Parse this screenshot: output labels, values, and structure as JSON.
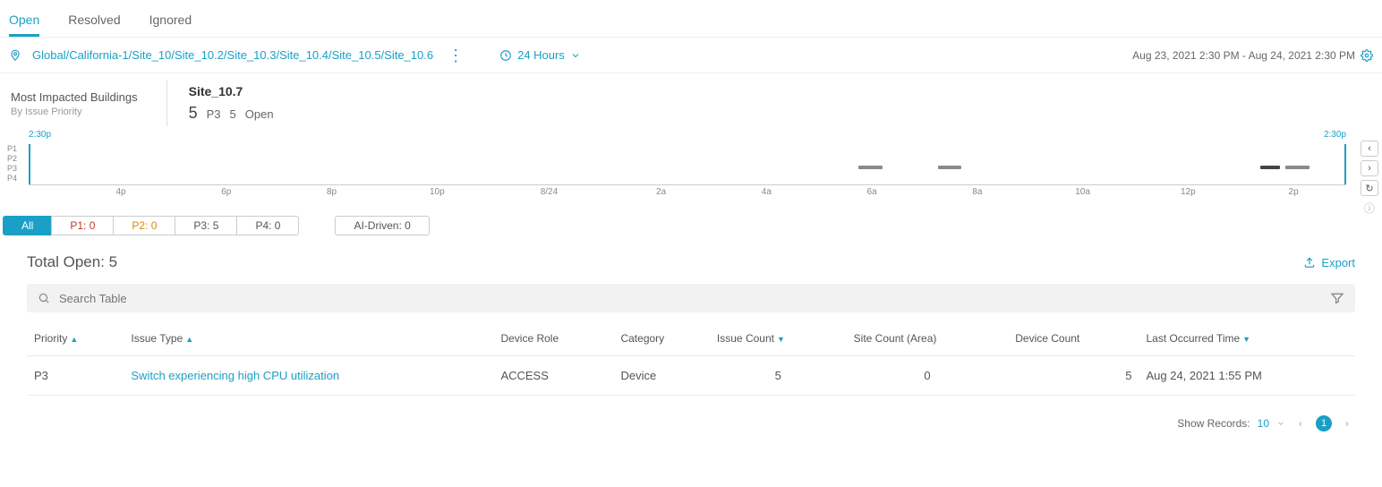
{
  "tabs": {
    "open": "Open",
    "resolved": "Resolved",
    "ignored": "Ignored"
  },
  "breadcrumb": "Global/California-1/Site_10/Site_10.2/Site_10.3/Site_10.4/Site_10.5/Site_10.6",
  "time_range_label": "24 Hours",
  "date_range": "Aug 23, 2021 2:30 PM - Aug 24, 2021 2:30 PM",
  "summary": {
    "mib_title": "Most Impacted Buildings",
    "mib_sub": "By Issue Priority",
    "site_name": "Site_10.7",
    "site_count": "5",
    "site_priority": "P3",
    "site_open_count": "5",
    "site_open_label": "Open"
  },
  "timeline": {
    "start_label": "2:30p",
    "end_label": "2:30p",
    "row_labels": [
      "P1",
      "P2",
      "P3",
      "P4"
    ],
    "xticks": [
      "4p",
      "6p",
      "8p",
      "10p",
      "8/24",
      "2a",
      "4a",
      "6a",
      "8a",
      "10a",
      "12p",
      "2p"
    ]
  },
  "filters": {
    "all": "All",
    "p1": "P1:  0",
    "p2": "P2:  0",
    "p3": "P3:  5",
    "p4": "P4:  0",
    "ai": "AI-Driven:  0"
  },
  "total_open_label": "Total Open: 5",
  "export_label": "Export",
  "search_placeholder": "Search Table",
  "columns": {
    "priority": "Priority",
    "issue_type": "Issue Type",
    "device_role": "Device Role",
    "category": "Category",
    "issue_count": "Issue Count",
    "site_count": "Site Count (Area)",
    "device_count": "Device Count",
    "last_occurred": "Last Occurred Time"
  },
  "rows": [
    {
      "priority": "P3",
      "issue_type": "Switch experiencing high CPU utilization",
      "device_role": "ACCESS",
      "category": "Device",
      "issue_count": "5",
      "site_count": "0",
      "device_count": "5",
      "last_occurred": "Aug 24, 2021 1:55 PM"
    }
  ],
  "pager": {
    "show_label": "Show Records:",
    "page_size": "10",
    "current": "1"
  },
  "chart_data": {
    "type": "bar",
    "title": "",
    "xlabel": "",
    "ylabel": "",
    "y_categories": [
      "P1",
      "P2",
      "P3",
      "P4"
    ],
    "x_range": [
      "2021-08-23T14:30",
      "2021-08-24T14:30"
    ],
    "series": [
      {
        "name": "P3",
        "segments": [
          {
            "start": "6a",
            "end": "6:30a"
          },
          {
            "start": "7:30a",
            "end": "8a"
          },
          {
            "start": "1:30p",
            "end": "1:45p",
            "shade": "dark"
          },
          {
            "start": "1:50p",
            "end": "2:15p"
          }
        ]
      }
    ]
  }
}
